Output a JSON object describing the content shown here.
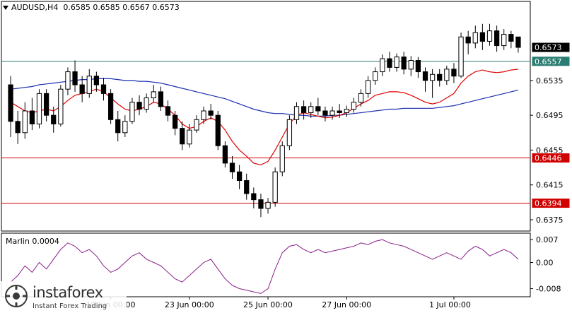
{
  "header": {
    "symbol": "AUDUSD,H4",
    "ohlc": "0.6585 0.6585 0.6567 0.6573"
  },
  "indicator": {
    "label": "Marlin 0.0004",
    "ticks": [
      "0.007",
      "0.00",
      "-0.008"
    ]
  },
  "logo": {
    "name": "instaforex",
    "tagline": "Instant Forex Trading"
  },
  "colors": {
    "bull": "#ffffff",
    "bear": "#000000",
    "red_ma": "#e00000",
    "blue_ma": "#1a2fb0",
    "level_red": "#d00000",
    "level_teal": "#2a7d72",
    "oscillator": "#8a1f8a",
    "grid": "#000000"
  },
  "chart_data": {
    "type": "candlestick",
    "timeframe": "H4",
    "price_ticks": [
      "0.6535",
      "0.6495",
      "0.6455",
      "0.6415",
      "0.6375"
    ],
    "price_range": [
      0.6362,
      0.6625
    ],
    "time_labels": [
      "19 Jun 00:00",
      "23 Jun 00:00",
      "25 Jun 00:00",
      "27 Jun 00:00",
      "1 Jul 00:00"
    ],
    "levels": [
      {
        "value": "0.6573",
        "color": "#000000",
        "type": "current"
      },
      {
        "value": "0.6557",
        "color": "#2a7d72",
        "type": "line"
      },
      {
        "value": "0.6446",
        "color": "#d00000",
        "type": "line"
      },
      {
        "value": "0.6394",
        "color": "#d00000",
        "type": "line"
      }
    ],
    "candles": [
      [
        0.653,
        0.6488,
        0.654,
        0.647
      ],
      [
        0.6488,
        0.6475,
        0.65,
        0.6462
      ],
      [
        0.6475,
        0.65,
        0.651,
        0.6468
      ],
      [
        0.65,
        0.6485,
        0.6515,
        0.6478
      ],
      [
        0.6485,
        0.652,
        0.6525,
        0.648
      ],
      [
        0.652,
        0.6495,
        0.6525,
        0.6488
      ],
      [
        0.6495,
        0.6485,
        0.6505,
        0.6475
      ],
      [
        0.6485,
        0.6525,
        0.653,
        0.6482
      ],
      [
        0.6525,
        0.6545,
        0.655,
        0.6518
      ],
      [
        0.6545,
        0.653,
        0.6558,
        0.6522
      ],
      [
        0.653,
        0.652,
        0.654,
        0.651
      ],
      [
        0.652,
        0.654,
        0.6548,
        0.6515
      ],
      [
        0.654,
        0.653,
        0.6545,
        0.6522
      ],
      [
        0.653,
        0.652,
        0.6538,
        0.6512
      ],
      [
        0.652,
        0.649,
        0.6525,
        0.6485
      ],
      [
        0.649,
        0.6475,
        0.65,
        0.6465
      ],
      [
        0.6475,
        0.6488,
        0.6495,
        0.647
      ],
      [
        0.6488,
        0.651,
        0.6515,
        0.6485
      ],
      [
        0.651,
        0.6502,
        0.6518,
        0.6495
      ],
      [
        0.6502,
        0.6515,
        0.652,
        0.6498
      ],
      [
        0.6515,
        0.6522,
        0.653,
        0.651
      ],
      [
        0.6522,
        0.6505,
        0.6528,
        0.65
      ],
      [
        0.6505,
        0.6495,
        0.6512,
        0.6488
      ],
      [
        0.6495,
        0.648,
        0.65,
        0.6472
      ],
      [
        0.648,
        0.6462,
        0.6488,
        0.6455
      ],
      [
        0.6462,
        0.6478,
        0.6485,
        0.6458
      ],
      [
        0.6478,
        0.649,
        0.6495,
        0.6475
      ],
      [
        0.649,
        0.65,
        0.6505,
        0.6485
      ],
      [
        0.65,
        0.6495,
        0.6508,
        0.649
      ],
      [
        0.6495,
        0.646,
        0.65,
        0.6455
      ],
      [
        0.646,
        0.644,
        0.6465,
        0.6435
      ],
      [
        0.644,
        0.643,
        0.6448,
        0.6422
      ],
      [
        0.643,
        0.642,
        0.6438,
        0.641
      ],
      [
        0.642,
        0.6405,
        0.6428,
        0.6398
      ],
      [
        0.6405,
        0.6398,
        0.6412,
        0.6388
      ],
      [
        0.6398,
        0.6388,
        0.6405,
        0.6378
      ],
      [
        0.6388,
        0.6395,
        0.64,
        0.6382
      ],
      [
        0.6395,
        0.643,
        0.6435,
        0.639
      ],
      [
        0.643,
        0.646,
        0.6465,
        0.6425
      ],
      [
        0.646,
        0.649,
        0.6495,
        0.6455
      ],
      [
        0.649,
        0.6505,
        0.651,
        0.6485
      ],
      [
        0.6505,
        0.6498,
        0.6512,
        0.649
      ],
      [
        0.6498,
        0.6505,
        0.651,
        0.6492
      ],
      [
        0.6505,
        0.65,
        0.6515,
        0.6495
      ],
      [
        0.65,
        0.6495,
        0.6505,
        0.6488
      ],
      [
        0.6495,
        0.65,
        0.6505,
        0.649
      ],
      [
        0.65,
        0.6498,
        0.6508,
        0.6492
      ],
      [
        0.6498,
        0.6502,
        0.6506,
        0.6493
      ],
      [
        0.6502,
        0.651,
        0.6515,
        0.6498
      ],
      [
        0.651,
        0.652,
        0.6525,
        0.6505
      ],
      [
        0.652,
        0.6535,
        0.654,
        0.6515
      ],
      [
        0.6535,
        0.6545,
        0.655,
        0.653
      ],
      [
        0.6545,
        0.656,
        0.6565,
        0.654
      ],
      [
        0.656,
        0.655,
        0.6568,
        0.6545
      ],
      [
        0.655,
        0.6562,
        0.6566,
        0.6545
      ],
      [
        0.6562,
        0.6548,
        0.6568,
        0.6542
      ],
      [
        0.6548,
        0.6558,
        0.6563,
        0.654
      ],
      [
        0.6558,
        0.6545,
        0.6562,
        0.6538
      ],
      [
        0.6545,
        0.6535,
        0.655,
        0.6522
      ],
      [
        0.6535,
        0.6542,
        0.6548,
        0.6515
      ],
      [
        0.6542,
        0.6535,
        0.6548,
        0.6528
      ],
      [
        0.6535,
        0.6548,
        0.6552,
        0.653
      ],
      [
        0.6548,
        0.654,
        0.6555,
        0.6532
      ],
      [
        0.654,
        0.6585,
        0.659,
        0.6538
      ],
      [
        0.6585,
        0.6578,
        0.6592,
        0.6565
      ],
      [
        0.6578,
        0.659,
        0.6598,
        0.6572
      ],
      [
        0.659,
        0.658,
        0.66,
        0.657
      ],
      [
        0.658,
        0.6592,
        0.66,
        0.6575
      ],
      [
        0.6592,
        0.6575,
        0.6598,
        0.6568
      ],
      [
        0.6575,
        0.6588,
        0.6594,
        0.657
      ],
      [
        0.6588,
        0.658,
        0.6592,
        0.6572
      ],
      [
        0.6585,
        0.6573,
        0.6585,
        0.6567
      ]
    ],
    "ma_red": [
      0.651,
      0.6505,
      0.65,
      0.6498,
      0.65,
      0.6502,
      0.65,
      0.6505,
      0.6512,
      0.6518,
      0.652,
      0.6522,
      0.6525,
      0.6522,
      0.6515,
      0.6508,
      0.6502,
      0.65,
      0.6502,
      0.6505,
      0.651,
      0.6508,
      0.6502,
      0.6495,
      0.6485,
      0.648,
      0.6482,
      0.6488,
      0.6492,
      0.6488,
      0.6478,
      0.6465,
      0.6455,
      0.6448,
      0.644,
      0.6438,
      0.6442,
      0.6455,
      0.647,
      0.6485,
      0.6495,
      0.6498,
      0.6496,
      0.6494,
      0.6492,
      0.6493,
      0.6495,
      0.6498,
      0.6503,
      0.6508,
      0.6512,
      0.6518,
      0.652,
      0.6522,
      0.6522,
      0.6521,
      0.6518,
      0.6514,
      0.651,
      0.6508,
      0.651,
      0.6515,
      0.652,
      0.6532,
      0.654,
      0.6545,
      0.6547,
      0.6545,
      0.6544,
      0.6545,
      0.6547,
      0.6548
    ],
    "ma_blue": [
      0.6525,
      0.6526,
      0.6527,
      0.6528,
      0.653,
      0.6531,
      0.6532,
      0.6533,
      0.6534,
      0.6535,
      0.6536,
      0.6536,
      0.6537,
      0.6537,
      0.6537,
      0.6536,
      0.6535,
      0.6535,
      0.6534,
      0.6534,
      0.6533,
      0.6532,
      0.653,
      0.6528,
      0.6526,
      0.6524,
      0.6522,
      0.652,
      0.6518,
      0.6516,
      0.6514,
      0.6511,
      0.6508,
      0.6505,
      0.6502,
      0.65,
      0.6498,
      0.6497,
      0.6497,
      0.6496,
      0.6495,
      0.6495,
      0.6494,
      0.6494,
      0.6494,
      0.6495,
      0.6495,
      0.6496,
      0.6497,
      0.6498,
      0.6499,
      0.65,
      0.6501,
      0.6502,
      0.6502,
      0.6503,
      0.6503,
      0.6503,
      0.6503,
      0.6503,
      0.6504,
      0.6505,
      0.6506,
      0.6508,
      0.651,
      0.6512,
      0.6514,
      0.6516,
      0.6518,
      0.652,
      0.6522,
      0.6524
    ],
    "oscillator_range": [
      -0.0105,
      0.009
    ],
    "oscillator": [
      -0.006,
      -0.004,
      -0.001,
      -0.003,
      0.0,
      -0.002,
      0.001,
      0.004,
      0.006,
      0.005,
      0.003,
      0.004,
      0.002,
      -0.001,
      -0.003,
      -0.002,
      0.0,
      0.002,
      0.003,
      0.001,
      0.0,
      -0.001,
      -0.003,
      -0.005,
      -0.006,
      -0.004,
      -0.002,
      0.0,
      0.001,
      -0.002,
      -0.005,
      -0.007,
      -0.008,
      -0.0085,
      -0.009,
      -0.0095,
      -0.008,
      -0.002,
      0.003,
      0.005,
      0.0055,
      0.004,
      0.003,
      0.004,
      0.003,
      0.0035,
      0.004,
      0.0045,
      0.005,
      0.006,
      0.0055,
      0.0065,
      0.007,
      0.006,
      0.0055,
      0.005,
      0.004,
      0.003,
      0.002,
      0.001,
      0.002,
      0.003,
      0.002,
      0.001,
      0.0035,
      0.005,
      0.004,
      0.002,
      0.003,
      0.004,
      0.003,
      0.001
    ]
  }
}
